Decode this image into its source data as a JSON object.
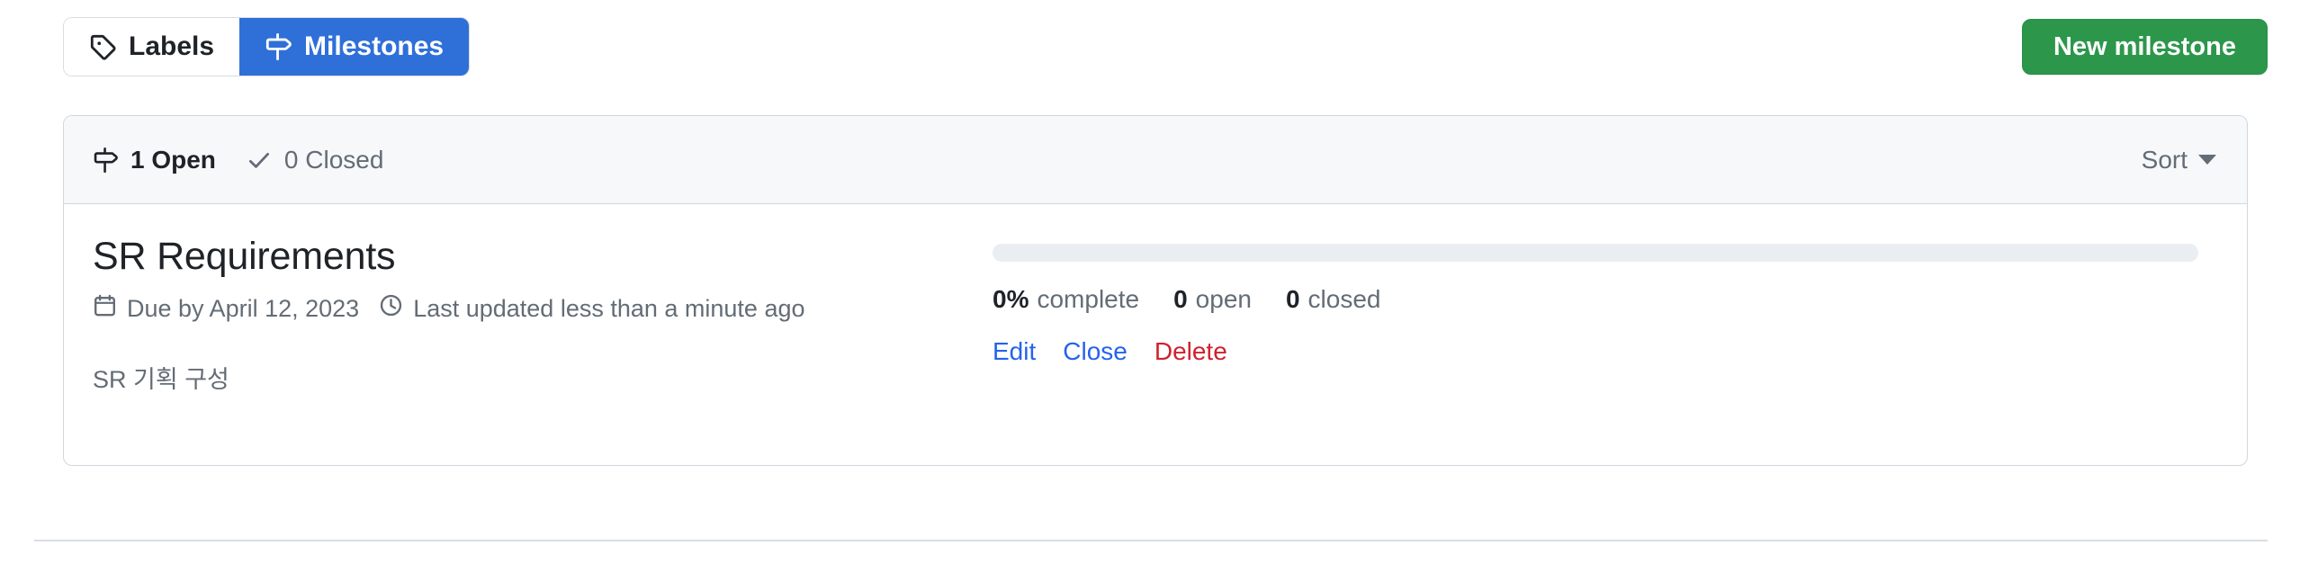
{
  "tabs": [
    {
      "label": "Labels",
      "icon": "tag-icon",
      "active": false
    },
    {
      "label": "Milestones",
      "icon": "milestone-icon",
      "active": true
    }
  ],
  "actions": {
    "new_milestone_label": "New milestone"
  },
  "panel_header": {
    "open": {
      "label": "1 Open",
      "icon": "milestone-icon"
    },
    "closed": {
      "label": "0 Closed",
      "icon": "check-icon"
    },
    "sort_label": "Sort"
  },
  "milestone": {
    "title": "SR Requirements",
    "due": {
      "icon": "calendar-icon",
      "label": "Due by April 12, 2023"
    },
    "updated": {
      "icon": "clock-icon",
      "label": "Last updated less than a minute ago"
    },
    "description": "SR 기획 구성",
    "progress": {
      "percent": 0,
      "percent_label": "0%",
      "complete_label": "complete"
    },
    "stats": {
      "open_count": "0",
      "open_label": "open",
      "closed_count": "0",
      "closed_label": "closed"
    },
    "links": {
      "edit": "Edit",
      "close": "Close",
      "delete": "Delete"
    }
  },
  "colors": {
    "tab_active_bg": "#2f6fd8",
    "new_button_bg": "#2c974b",
    "link_blue": "#2563eb",
    "danger_red": "#cf222e",
    "header_bg": "#f6f8fa",
    "border": "#d0d7de",
    "muted_text": "#636c76"
  }
}
